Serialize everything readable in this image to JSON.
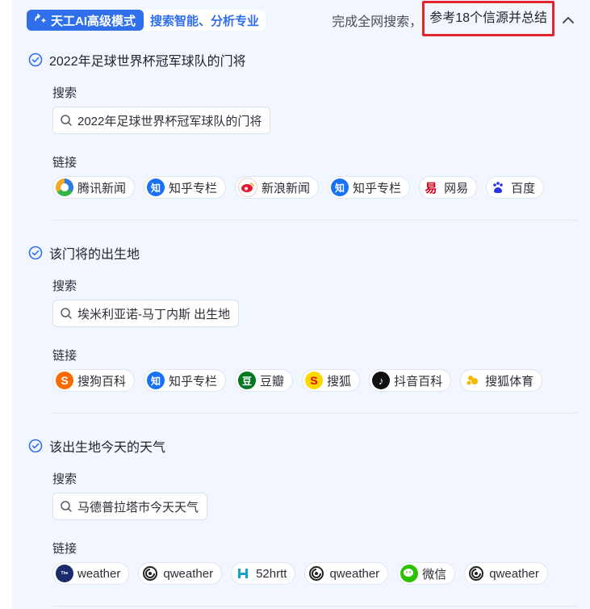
{
  "header": {
    "mode_label": "天工AI高级模式",
    "mode_subtitle": "搜索智能、分析专业",
    "summary_prefix": "完成全网搜索，",
    "summary_highlight": "参考18个信源并总结"
  },
  "labels": {
    "search": "搜索",
    "links": "链接"
  },
  "steps": [
    {
      "title": "2022年足球世界杯冠军球队的门将",
      "query": "2022年足球世界杯冠军球队的门将",
      "links": [
        {
          "label": "腾讯新闻",
          "icon": "tencent-news-icon"
        },
        {
          "label": "知乎专栏",
          "icon": "zhihu-icon"
        },
        {
          "label": "新浪新闻",
          "icon": "sina-icon"
        },
        {
          "label": "知乎专栏",
          "icon": "zhihu-icon"
        },
        {
          "label": "网易",
          "icon": "netease-icon"
        },
        {
          "label": "百度",
          "icon": "baidu-icon"
        }
      ]
    },
    {
      "title": "该门将的出生地",
      "query": "埃米利亚诺-马丁内斯 出生地",
      "links": [
        {
          "label": "搜狗百科",
          "icon": "sogou-icon"
        },
        {
          "label": "知乎专栏",
          "icon": "zhihu-icon"
        },
        {
          "label": "豆瓣",
          "icon": "douban-icon"
        },
        {
          "label": "搜狐",
          "icon": "sohu-icon"
        },
        {
          "label": "抖音百科",
          "icon": "douyin-icon"
        },
        {
          "label": "搜狐体育",
          "icon": "sohu-sports-icon"
        }
      ]
    },
    {
      "title": "该出生地今天的天气",
      "query": "马德普拉塔市今天天气",
      "links": [
        {
          "label": "weather",
          "icon": "weather-channel-icon"
        },
        {
          "label": "qweather",
          "icon": "qweather-icon"
        },
        {
          "label": "52hrtt",
          "icon": "52hrtt-icon"
        },
        {
          "label": "qweather",
          "icon": "qweather-icon"
        },
        {
          "label": "微信",
          "icon": "wechat-icon"
        },
        {
          "label": "qweather",
          "icon": "qweather-icon"
        }
      ]
    }
  ],
  "colors": {
    "accent": "#2f6fec",
    "highlight_border": "#e3242b",
    "panel_bg": "#f1f6ff"
  }
}
